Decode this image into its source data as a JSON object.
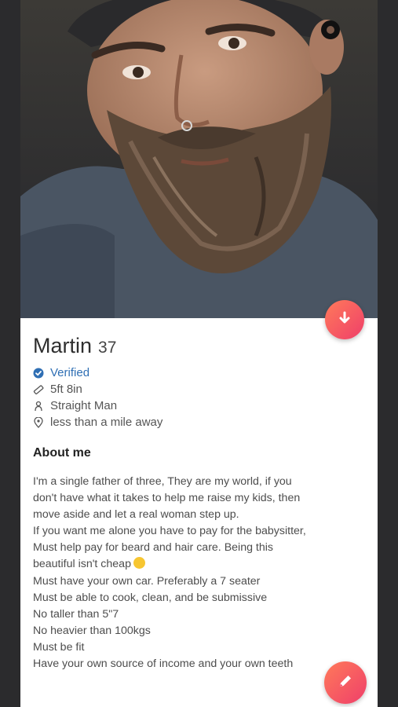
{
  "profile": {
    "name": "Martin",
    "age": "37",
    "verified": "Verified",
    "height": "5ft 8in",
    "orientation": "Straight Man",
    "distance": "less than a mile away"
  },
  "about": {
    "title": "About me",
    "lines": [
      "I'm a single father of three, They are my world, if you",
      "don't have what it takes to help me raise my kids, then",
      "move aside and let a real woman step up.",
      "If you want me alone you have to pay for the babysitter,",
      "Must help pay for beard and hair care. Being this",
      "beautiful isn't cheap",
      "Must have your own car. Preferably a 7 seater",
      "Must be able to cook, clean, and be submissive",
      "No taller than 5\"7",
      "No heavier than 100kgs",
      "Must be fit",
      "Have your own source of income and your own teeth"
    ]
  },
  "icons": {
    "down": "arrow-down-icon",
    "edit": "pencil-icon",
    "verified": "check-badge-icon",
    "height": "ruler-icon",
    "orientation": "person-icon",
    "distance": "location-pin-icon",
    "emoji": "smirk-emoji-icon"
  },
  "colors": {
    "accent_start": "#ff7a5a",
    "accent_end": "#ef3f6a",
    "verified": "#2f6fb4"
  }
}
